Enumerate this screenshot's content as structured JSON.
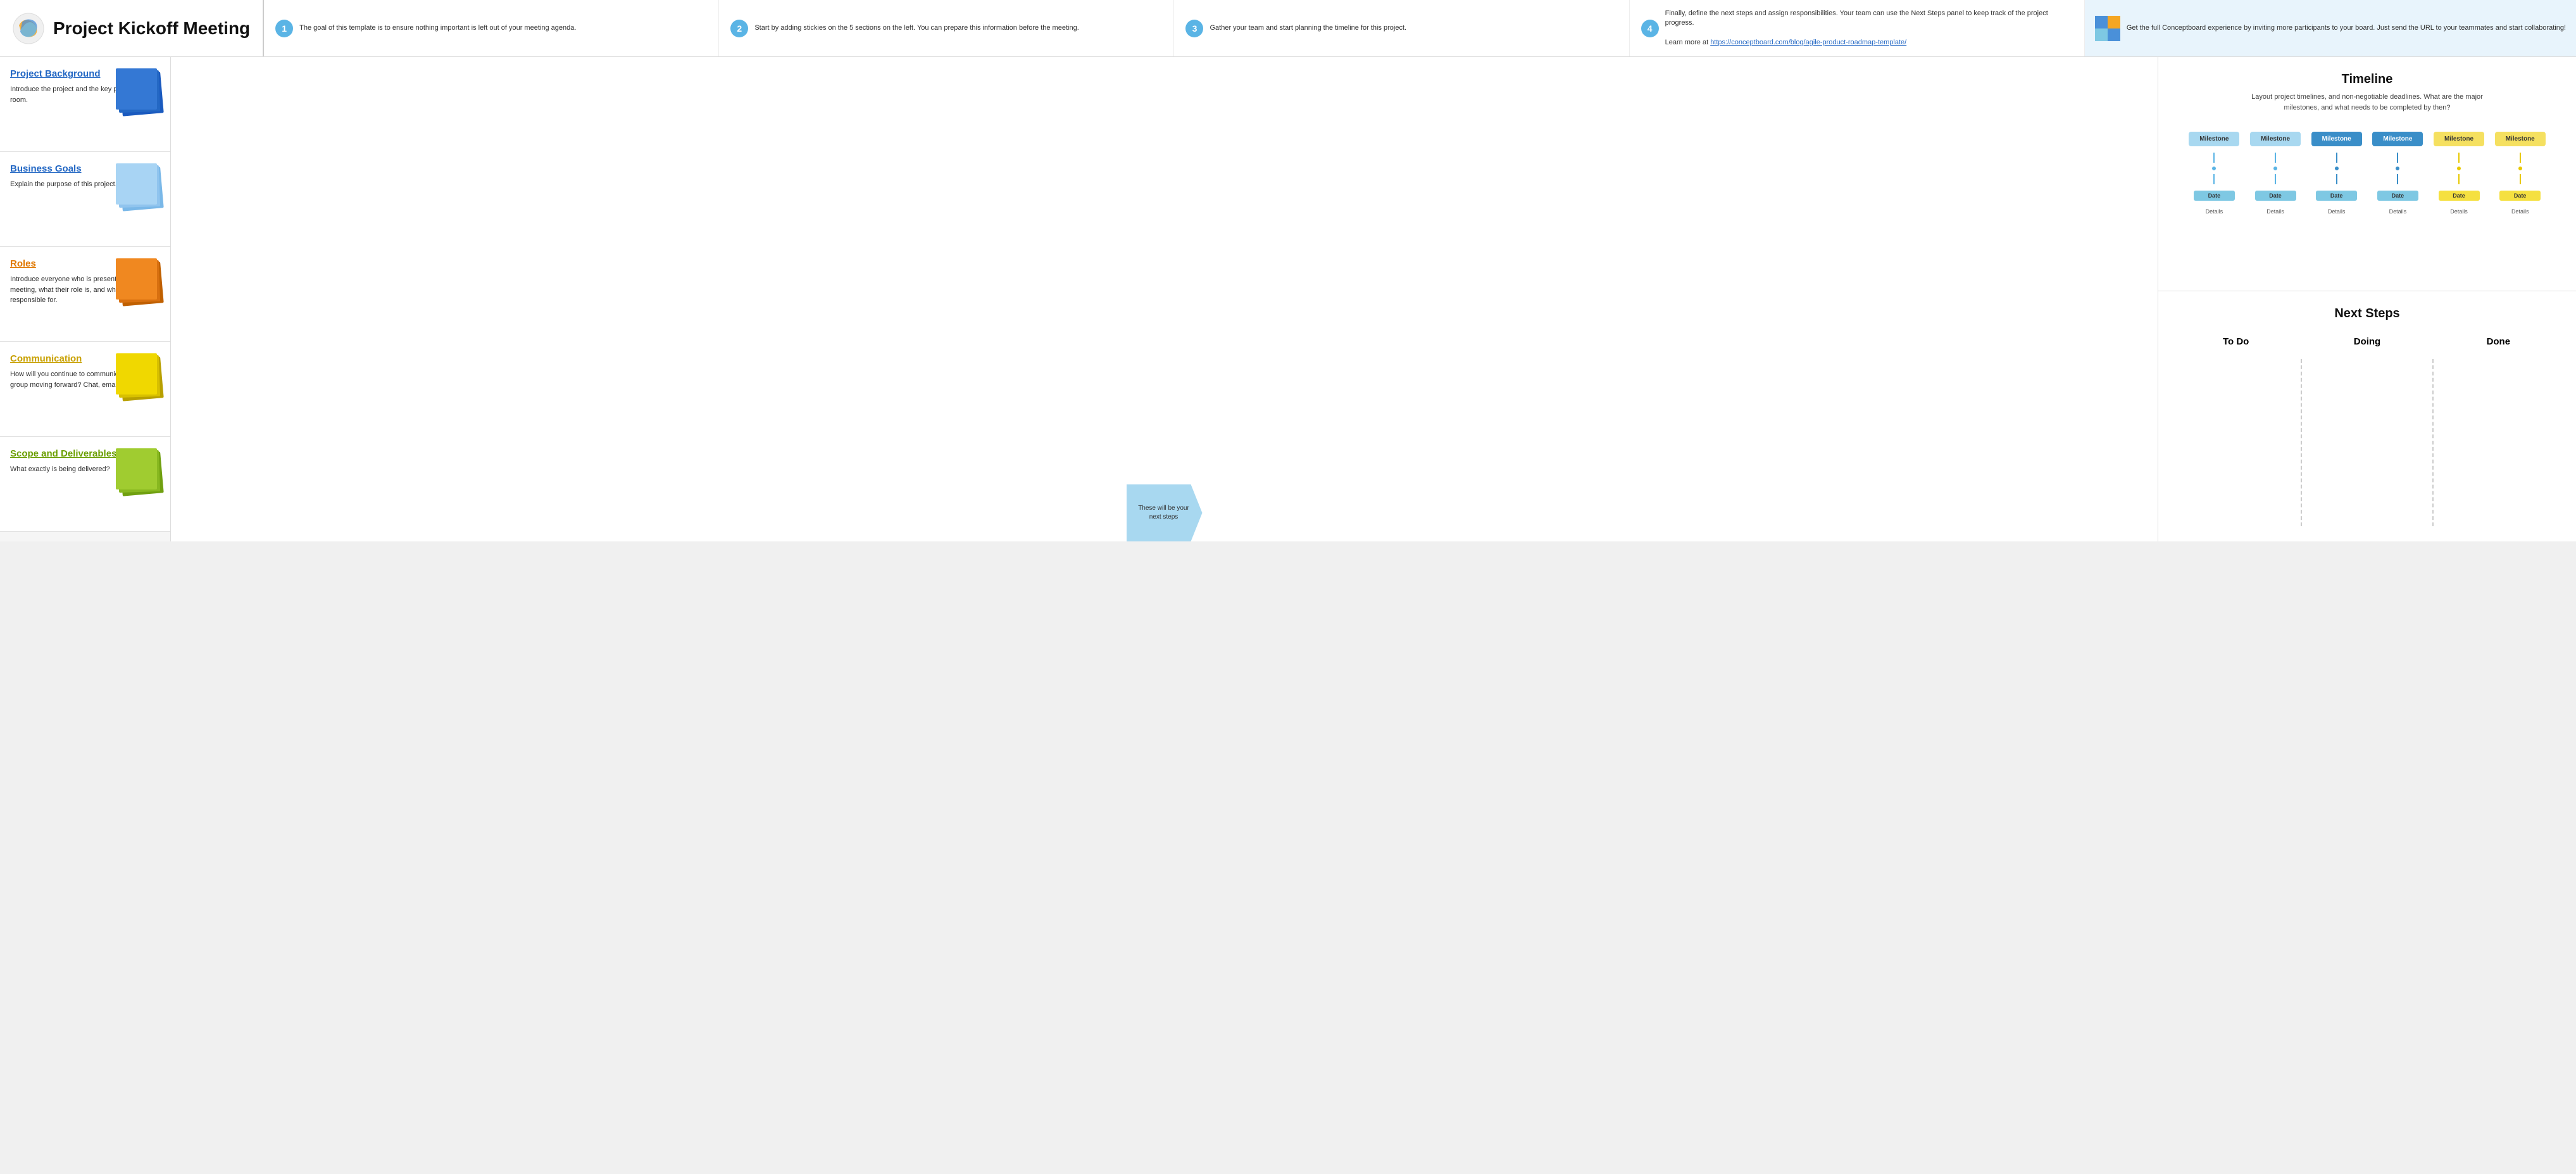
{
  "header": {
    "title": "Project Kickoff Meeting",
    "steps": [
      {
        "num": "1",
        "text": "The goal of this template is to ensure nothing important is left out of your meeting agenda."
      },
      {
        "num": "2",
        "text": "Start by adding stickies on the 5 sections on the left. You can prepare this information before the meeting."
      },
      {
        "num": "3",
        "text": "Gather your team and start planning the timeline for this project."
      },
      {
        "num": "4",
        "text": "Finally, define the next steps and assign responsibilities. Your team can use the Next Steps panel to keep track of the project progress.\n\nLearn more at https://conceptboard.com/blog/agile-product-roadmap-template/"
      }
    ],
    "promo": {
      "text": "Get the full Conceptboard experience by inviting more participants to your board. Just send the URL to your teammates and start collaborating!"
    }
  },
  "sections": [
    {
      "title": "Project Background",
      "title_color": "blue",
      "desc": "Introduce the project and the key people in the room.",
      "sticky_color": "blue"
    },
    {
      "title": "Business Goals",
      "title_color": "blue",
      "desc": "Explain the purpose of this project.",
      "sticky_color": "light-blue"
    },
    {
      "title": "Roles",
      "title_color": "orange",
      "desc": "Introduce everyone who is present in the meeting, what their role is, and what they are responsible for.",
      "sticky_color": "orange"
    },
    {
      "title": "Communication",
      "title_color": "yellow",
      "desc": "How will you continue to communicate as a group moving forward? Chat, email, meetings?",
      "sticky_color": "yellow"
    },
    {
      "title": "Scope and Deliverables",
      "title_color": "green",
      "desc": "What exactly is being delivered?",
      "sticky_color": "green"
    }
  ],
  "timeline": {
    "title": "Timeline",
    "subtitle": "Layout project timelines, and non-negotiable deadlines. What are the major\nmilestones, and what needs to be completed by then?",
    "milestones": [
      {
        "label": "Milestone",
        "type": "blue-light",
        "date_type": "blue",
        "dot_type": "blue"
      },
      {
        "label": "Milestone",
        "type": "blue-light",
        "date_type": "blue",
        "dot_type": "blue"
      },
      {
        "label": "Milestone",
        "type": "blue-dark",
        "date_type": "blue",
        "dot_type": "blue"
      },
      {
        "label": "Milestone",
        "type": "blue-dark",
        "date_type": "blue",
        "dot_type": "blue"
      },
      {
        "label": "Milestone",
        "type": "yellow",
        "date_type": "yellow",
        "dot_type": "yellow"
      },
      {
        "label": "Milestone",
        "type": "yellow",
        "date_type": "yellow",
        "dot_type": "yellow"
      }
    ],
    "date_label": "Date",
    "details_label": "Details"
  },
  "next_steps": {
    "title": "Next Steps",
    "columns": [
      {
        "label": "To Do"
      },
      {
        "label": "Doing"
      },
      {
        "label": "Done"
      }
    ]
  },
  "arrow": {
    "text": "These will be your next steps"
  }
}
